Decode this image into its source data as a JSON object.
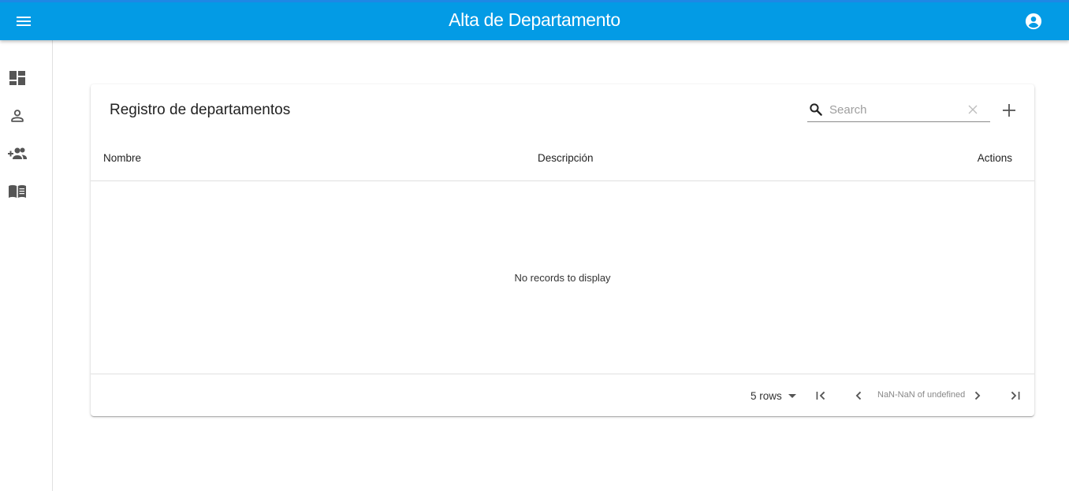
{
  "appbar": {
    "title": "Alta de Departamento",
    "color": "#039be5",
    "menu_icon": "menu-icon",
    "account_icon": "account-circle-icon"
  },
  "drawer": {
    "items": [
      {
        "icon": "dashboard-icon"
      },
      {
        "icon": "person-icon"
      },
      {
        "icon": "group-add-icon"
      },
      {
        "icon": "menu-book-icon"
      }
    ]
  },
  "table": {
    "title": "Registro de departamentos",
    "search": {
      "placeholder": "Search",
      "value": ""
    },
    "columns": [
      "Nombre",
      "Descripción",
      "Actions"
    ],
    "empty_message": "No records to display",
    "pagination": {
      "rows_label": "5 rows",
      "page_info": "NaN-NaN of undefined"
    }
  }
}
